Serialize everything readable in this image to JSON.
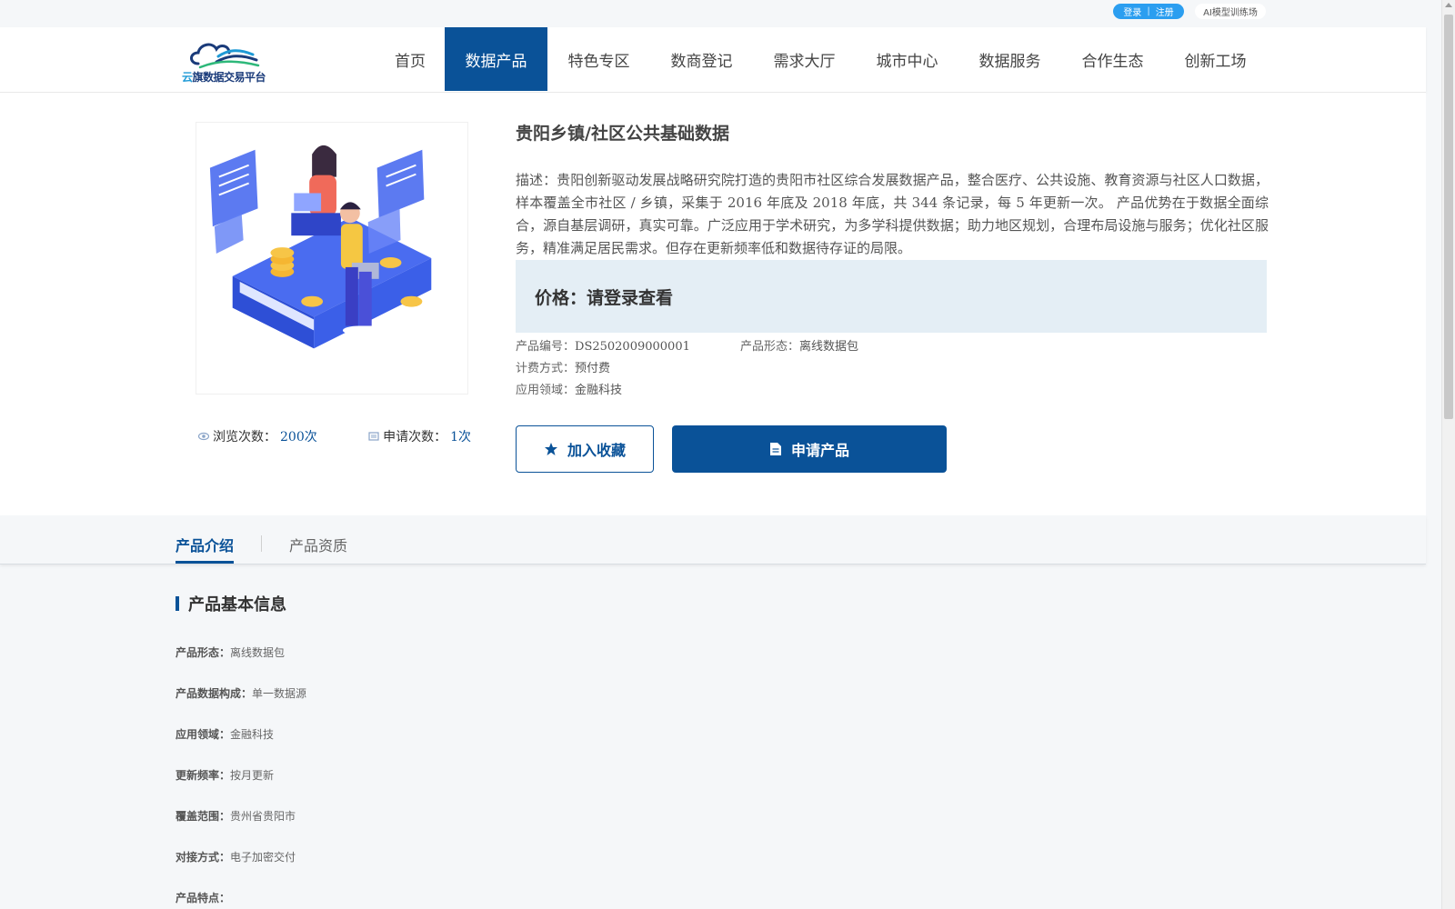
{
  "topbar": {
    "login": "登录",
    "register": "注册",
    "separator": "|",
    "ai_link": "AI模型训练场"
  },
  "brand": {
    "name_part1": "云",
    "name_part2": "旗数据交易平台",
    "accent_color": "#1e9ad6",
    "primary_color": "#0a5298"
  },
  "nav": {
    "items": [
      {
        "label": "首页"
      },
      {
        "label": "数据产品"
      },
      {
        "label": "特色专区"
      },
      {
        "label": "数商登记"
      },
      {
        "label": "需求大厅"
      },
      {
        "label": "城市中心"
      },
      {
        "label": "数据服务"
      },
      {
        "label": "合作生态"
      },
      {
        "label": "创新工场"
      }
    ],
    "active_index": 1
  },
  "product": {
    "title": "贵阳乡镇/社区公共基础数据",
    "description": "描述：贵阳创新驱动发展战略研究院打造的贵阳市社区综合发展数据产品，整合医疗、公共设施、教育资源与社区人口数据，样本覆盖全市社区 / 乡镇，采集于 2016 年底及 2018 年底，共 344 条记录，每 5 年更新一次。 产品优势在于数据全面综合，源自基层调研，真实可靠。广泛应用于学术研究，为多学科提供数据；助力地区规划，合理布局设施与服务；优化社区服务，精准满足居民需求。但存在更新频率低和数据待存证的局限。",
    "price": "价格：请登录查看",
    "code_label": "产品编号：",
    "code_value": "DS2502009000001",
    "form_label": "产品形态：",
    "form_value": "离线数据包",
    "billing_label": "计费方式：",
    "billing_value": "预付费",
    "domain_label": "应用领域：",
    "domain_value": "金融科技",
    "views_label": "浏览次数：",
    "views_value": "200次",
    "applies_label": "申请次数：",
    "applies_value": "1次",
    "favorite_button": "加入收藏",
    "apply_button": "申请产品"
  },
  "tabs": {
    "items": [
      {
        "label": "产品介绍"
      },
      {
        "label": "产品资质"
      }
    ],
    "active_index": 0
  },
  "basic_info": {
    "heading": "产品基本信息",
    "rows": [
      {
        "key": "产品形态：",
        "value": "离线数据包"
      },
      {
        "key": "产品数据构成：",
        "value": "单一数据源"
      },
      {
        "key": "应用领域：",
        "value": "金融科技"
      },
      {
        "key": "更新频率：",
        "value": "按月更新"
      },
      {
        "key": "覆盖范围：",
        "value": "贵州省贵阳市"
      },
      {
        "key": "对接方式：",
        "value": "电子加密交付"
      },
      {
        "key": "产品特点：",
        "value": ""
      }
    ]
  },
  "icons": {
    "logo": "cloud-wave-logo",
    "views": "eye-icon",
    "applies": "document-icon",
    "favorite": "star-icon",
    "apply": "file-icon"
  }
}
